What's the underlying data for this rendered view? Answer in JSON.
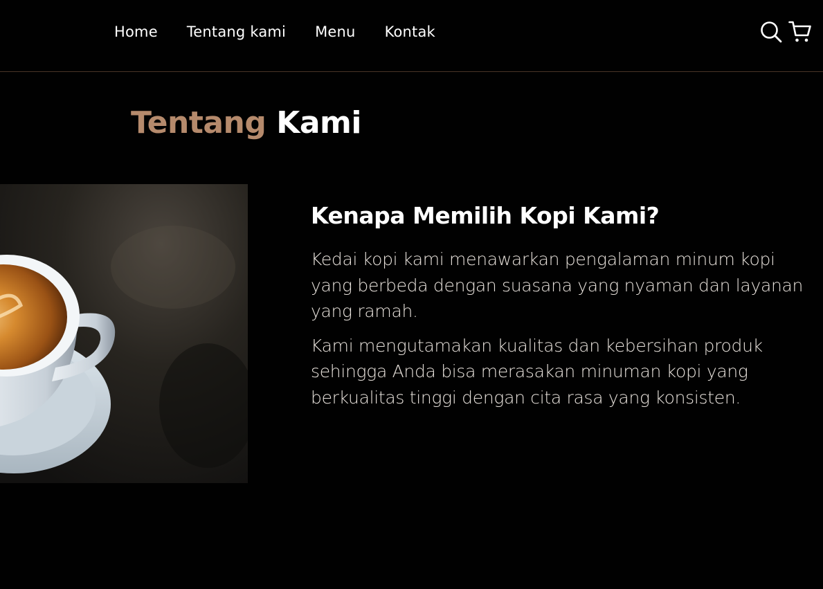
{
  "nav": {
    "items": [
      {
        "label": "Home"
      },
      {
        "label": "Tentang kami"
      },
      {
        "label": "Menu"
      },
      {
        "label": "Kontak"
      }
    ],
    "icons": [
      "search-icon",
      "shopping-cart-icon"
    ]
  },
  "about": {
    "title_accent": "Tentang",
    "title_main": "Kami",
    "heading": "Kenapa Memilih Kopi Kami?",
    "paragraphs": [
      "Kedai kopi kami menawarkan pengalaman minum kopi yang berbeda dengan suasana yang nyaman dan layanan yang ramah.",
      "Kami mengutamakan kualitas dan kebersihan produk sehingga Anda bisa merasakan minuman kopi yang berkualitas tinggi dengan cita rasa yang konsisten."
    ]
  },
  "colors": {
    "background": "#010101",
    "accent": "#b58a6c",
    "text": "#ffffff",
    "divider": "#4a3427"
  }
}
